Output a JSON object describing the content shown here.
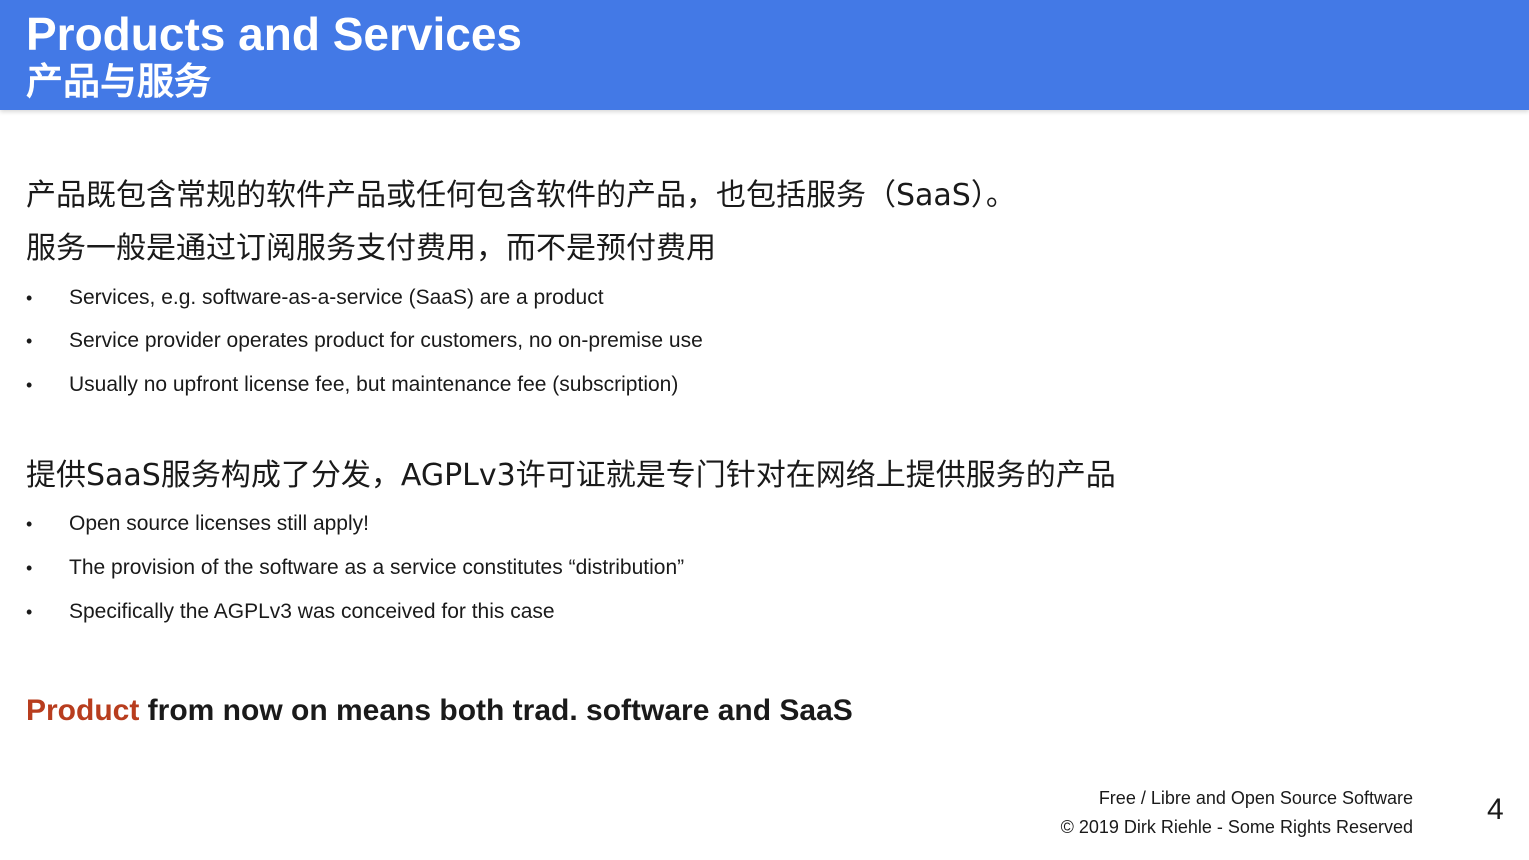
{
  "slide": {
    "title_en": "Products and Services",
    "title_zh": "产品与服务"
  },
  "section1": {
    "heading_line1": "产品既包含常规的软件产品或任何包含软件的产品，也包括服务（SaaS）。",
    "heading_line2": "服务一般是通过订阅服务支付费用，而不是预付费用",
    "bullets": [
      "Services, e.g. software-as-a-service (SaaS) are a product",
      "Service provider operates product for customers, no on-premise use",
      "Usually no upfront license fee, but maintenance fee (subscription)"
    ]
  },
  "section2": {
    "heading": "提供SaaS服务构成了分发，AGPLv3许可证就是专门针对在网络上提供服务的产品",
    "bullets": [
      "Open source licenses still apply!",
      "The provision of the software as a service constitutes “distribution”",
      "Specifically the AGPLv3 was conceived for this case"
    ]
  },
  "summary": {
    "accent_word": "Product",
    "rest": " from now on means both trad. software and SaaS"
  },
  "footer": {
    "line1": "Free / Libre and Open Source Software",
    "line2": "© 2019 Dirk Riehle - Some Rights Reserved"
  },
  "page_number": "4",
  "colors": {
    "header_bg": "#4379e6",
    "accent": "#b83d1e"
  }
}
